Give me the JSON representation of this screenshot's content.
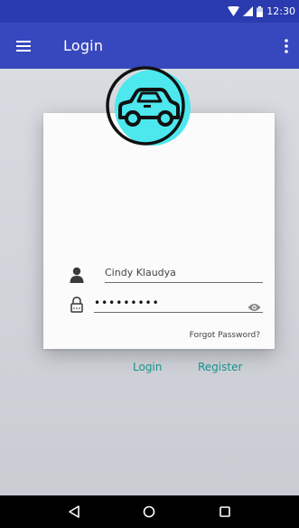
{
  "status_bar": {
    "time": "12:30"
  },
  "app_bar": {
    "title": "Login"
  },
  "form": {
    "username_value": "Cindy Klaudya",
    "password_value": "•••••••••",
    "forgot_password_label": "Forgot Password?",
    "login_label": "Login",
    "register_label": "Register"
  },
  "colors": {
    "primary": "#3747be",
    "status_bar": "#2a3bb0",
    "accent": "#16928a",
    "badge_cyan": "#4de8ee"
  },
  "icons": {
    "menu": "menu-icon",
    "overflow": "more-vert-icon",
    "car": "car-icon",
    "user": "person-icon",
    "lock": "lock-icon",
    "eye": "eye-icon",
    "back": "back-icon",
    "home": "home-icon",
    "recents": "recents-icon"
  }
}
